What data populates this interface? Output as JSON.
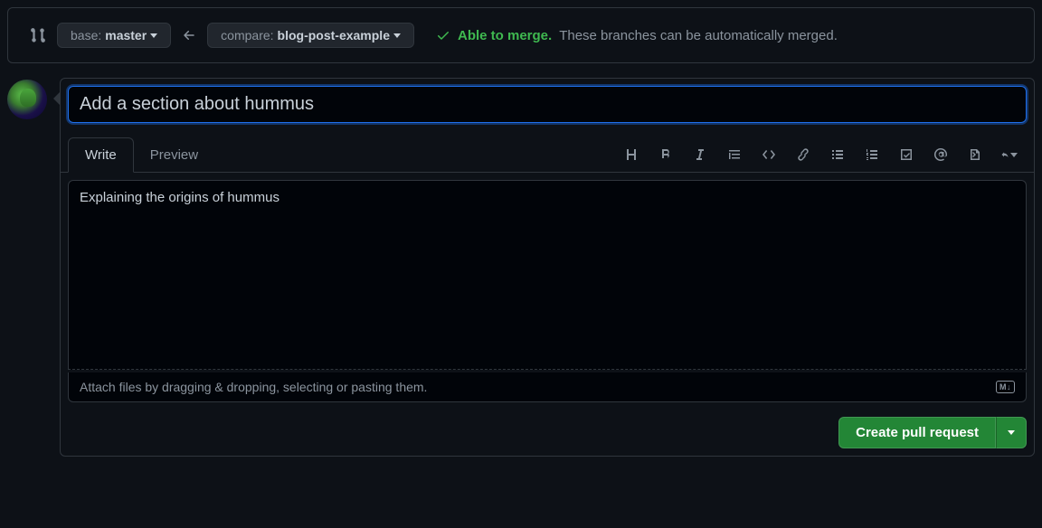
{
  "branch": {
    "base_label": "base:",
    "base_value": "master",
    "compare_label": "compare:",
    "compare_value": "blog-post-example"
  },
  "merge": {
    "able": "Able to merge.",
    "detail": "These branches can be automatically merged."
  },
  "form": {
    "title_value": "Add a section about hummus",
    "body_value": "Explaining the origins of hummus",
    "attach_hint": "Attach files by dragging & dropping, selecting or pasting them.",
    "md_badge": "M↓"
  },
  "tabs": {
    "write": "Write",
    "preview": "Preview"
  },
  "actions": {
    "create": "Create pull request"
  }
}
